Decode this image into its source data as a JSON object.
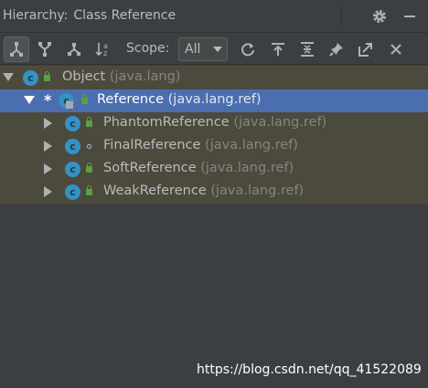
{
  "header": {
    "prefix": "Hierarchy:",
    "title": "Class Reference",
    "settings_icon": "gear-icon",
    "minimize_icon": "minimize-icon"
  },
  "toolbar": {
    "buttons": [
      {
        "name": "subtypes-hierarchy",
        "icon": "subtypes-hierarchy-icon",
        "active": true
      },
      {
        "name": "supertypes-hierarchy",
        "icon": "supertypes-hierarchy-icon"
      },
      {
        "name": "class-hierarchy",
        "icon": "class-hierarchy-icon"
      },
      {
        "name": "sort-alphabetically",
        "icon": "sort-alphabetically-icon"
      }
    ],
    "scope_label": "Scope:",
    "scope_value": "All",
    "actions": [
      "refresh-icon",
      "export-icon",
      "expand-all-icon",
      "pin-icon",
      "open-in-editor-icon",
      "close-icon"
    ]
  },
  "tree": [
    {
      "name": "Object",
      "package": "(java.lang)",
      "expanded": true,
      "selected": false,
      "access": "public"
    },
    {
      "name": "Reference",
      "package": "(java.lang.ref)",
      "expanded": true,
      "selected": true,
      "marker": "*",
      "abstract": true,
      "access": "public"
    },
    {
      "name": "PhantomReference",
      "package": "(java.lang.ref)",
      "expanded": false,
      "selected": false,
      "access": "public"
    },
    {
      "name": "FinalReference",
      "package": "(java.lang.ref)",
      "expanded": false,
      "selected": false,
      "access": "package"
    },
    {
      "name": "SoftReference",
      "package": "(java.lang.ref)",
      "expanded": false,
      "selected": false,
      "access": "public"
    },
    {
      "name": "WeakReference",
      "package": "(java.lang.ref)",
      "expanded": false,
      "selected": false,
      "access": "public"
    }
  ],
  "watermark": "https://blog.csdn.net/qq_41522089",
  "colors": {
    "background": "#3c3f41",
    "tree_background": "#4b4a3d",
    "selection": "#4b6eaf",
    "class_icon": "#3592c4",
    "public_lock": "#5aa140"
  }
}
